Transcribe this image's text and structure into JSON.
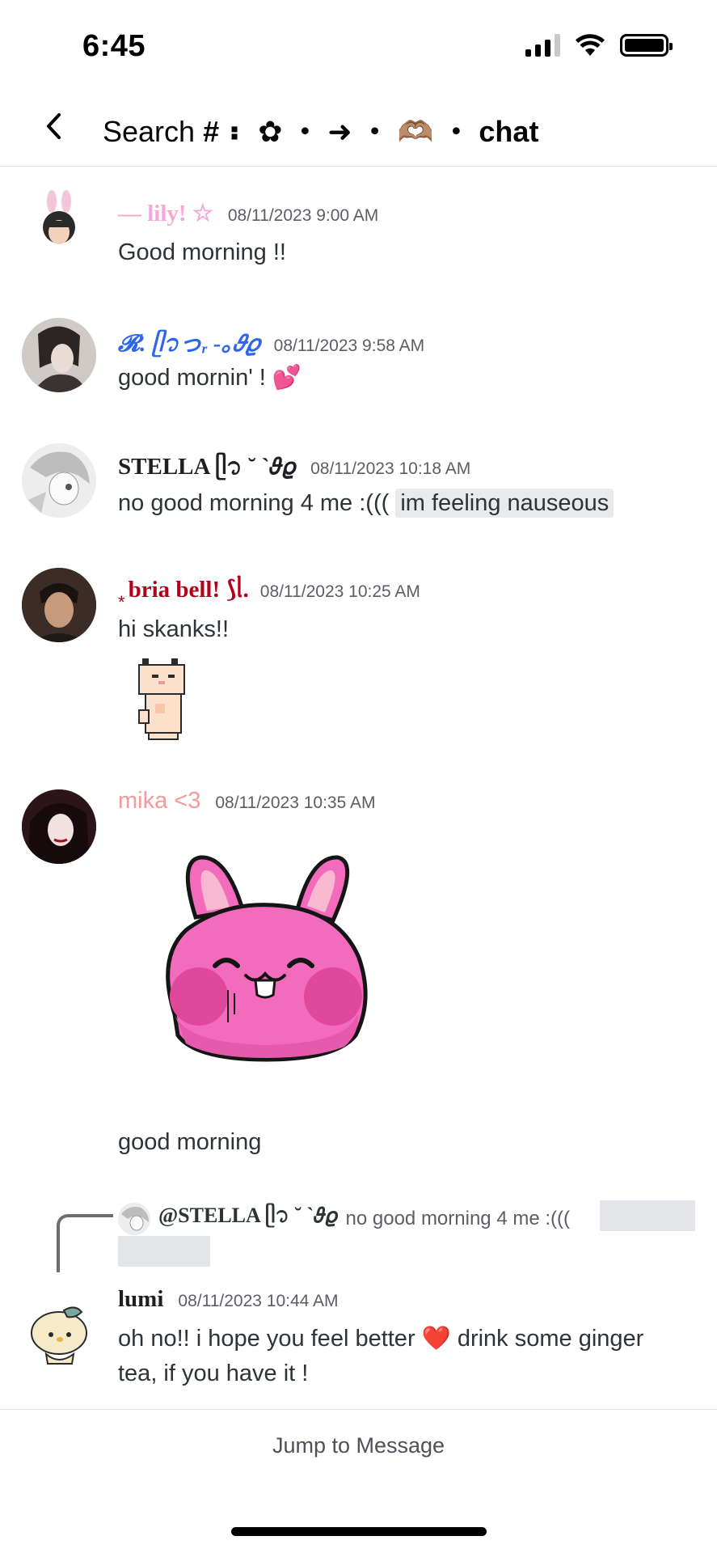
{
  "status": {
    "time": "6:45"
  },
  "header": {
    "title_prefix": "Search",
    "channel_name": "# ⠆ ✿ ・ ➜ ・ 🫶🏽 ・ chat"
  },
  "messages": [
    {
      "user": "— lily! ☆",
      "timestamp": "08/11/2023 9:00 AM",
      "text": "Good morning !!",
      "name_color": "#f5a8d6"
    },
    {
      "user": "𝓡. ᥫ᭡っᵣ -｡𝜗𝜚",
      "timestamp": "08/11/2023 9:58 AM",
      "text": "good mornin' ! 💕",
      "name_color": "#2f66e8"
    },
    {
      "user": "STELLA ᥫ᭡ ˘ ˋ𝜗𝜚",
      "timestamp": "08/11/2023 10:18 AM",
      "text": "no good morning 4 me :(((",
      "spoiler": "im feeling nauseous",
      "name_color": "#1e1f22"
    },
    {
      "user": "bria bell! ⟆ᥣ.",
      "user_prefix": "*",
      "timestamp": "08/11/2023 10:25 AM",
      "text": "hi skanks!!",
      "name_color": "#b3001b"
    },
    {
      "user": "mika <3",
      "timestamp": "08/11/2023 10:35 AM",
      "text": "good morning",
      "name_color": "#f29b9b"
    },
    {
      "user": "lumi",
      "timestamp": "08/11/2023 10:44 AM",
      "text_line1": "oh no!! i hope you feel better ❤️ drink some ginger",
      "text_line2": "tea, if you have it !",
      "name_color": "#1e1f22",
      "reply": {
        "user": "@STELLA ᥫ᭡ ˘ ˋ𝜗𝜚",
        "text": "no good morning 4 me :((("
      }
    }
  ],
  "bottom": {
    "jump_label": "Jump to Message"
  }
}
